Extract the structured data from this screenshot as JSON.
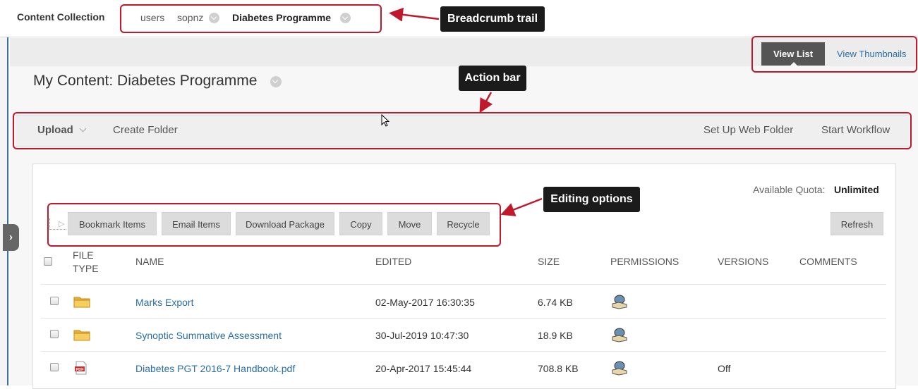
{
  "app": {
    "title": "Content Collection"
  },
  "breadcrumb": {
    "items": [
      "users",
      "sopnz",
      "Diabetes Programme"
    ]
  },
  "view_toggle": {
    "list": "View List",
    "thumbnails": "View Thumbnails"
  },
  "page": {
    "title": "My Content: Diabetes Programme"
  },
  "action_bar": {
    "upload": "Upload",
    "create_folder": "Create Folder",
    "web_folder": "Set Up Web Folder",
    "workflow": "Start Workflow"
  },
  "quota": {
    "label": "Available Quota:",
    "value": "Unlimited"
  },
  "editing_options": [
    "Bookmark Items",
    "Email Items",
    "Download Package",
    "Copy",
    "Move",
    "Recycle"
  ],
  "refresh": "Refresh",
  "table": {
    "headers": {
      "file_type_1": "FILE",
      "file_type_2": "TYPE",
      "name": "NAME",
      "edited": "EDITED",
      "size": "SIZE",
      "permissions": "PERMISSIONS",
      "versions": "VERSIONS",
      "comments": "COMMENTS"
    },
    "rows": [
      {
        "type": "folder-icon",
        "name": "Marks Export",
        "edited": "02-May-2017 16:30:35",
        "size": "6.74 KB",
        "versions": ""
      },
      {
        "type": "folder-icon",
        "name": "Synoptic Summative Assessment",
        "edited": "30-Jul-2019 10:47:30",
        "size": "18.9 KB",
        "versions": ""
      },
      {
        "type": "pdf-icon",
        "name": "Diabetes PGT 2016-7 Handbook.pdf",
        "edited": "20-Apr-2017 15:45:44",
        "size": "708.8 KB",
        "versions": "Off"
      }
    ]
  },
  "annotations": {
    "breadcrumb": "Breadcrumb trail",
    "action_bar": "Action bar",
    "editing": "Editing options"
  },
  "colors": {
    "accent_red": "#c0182c",
    "link_blue": "#2a6ea6",
    "dark_button": "#555555",
    "callout_bg": "#1b1b1b"
  }
}
